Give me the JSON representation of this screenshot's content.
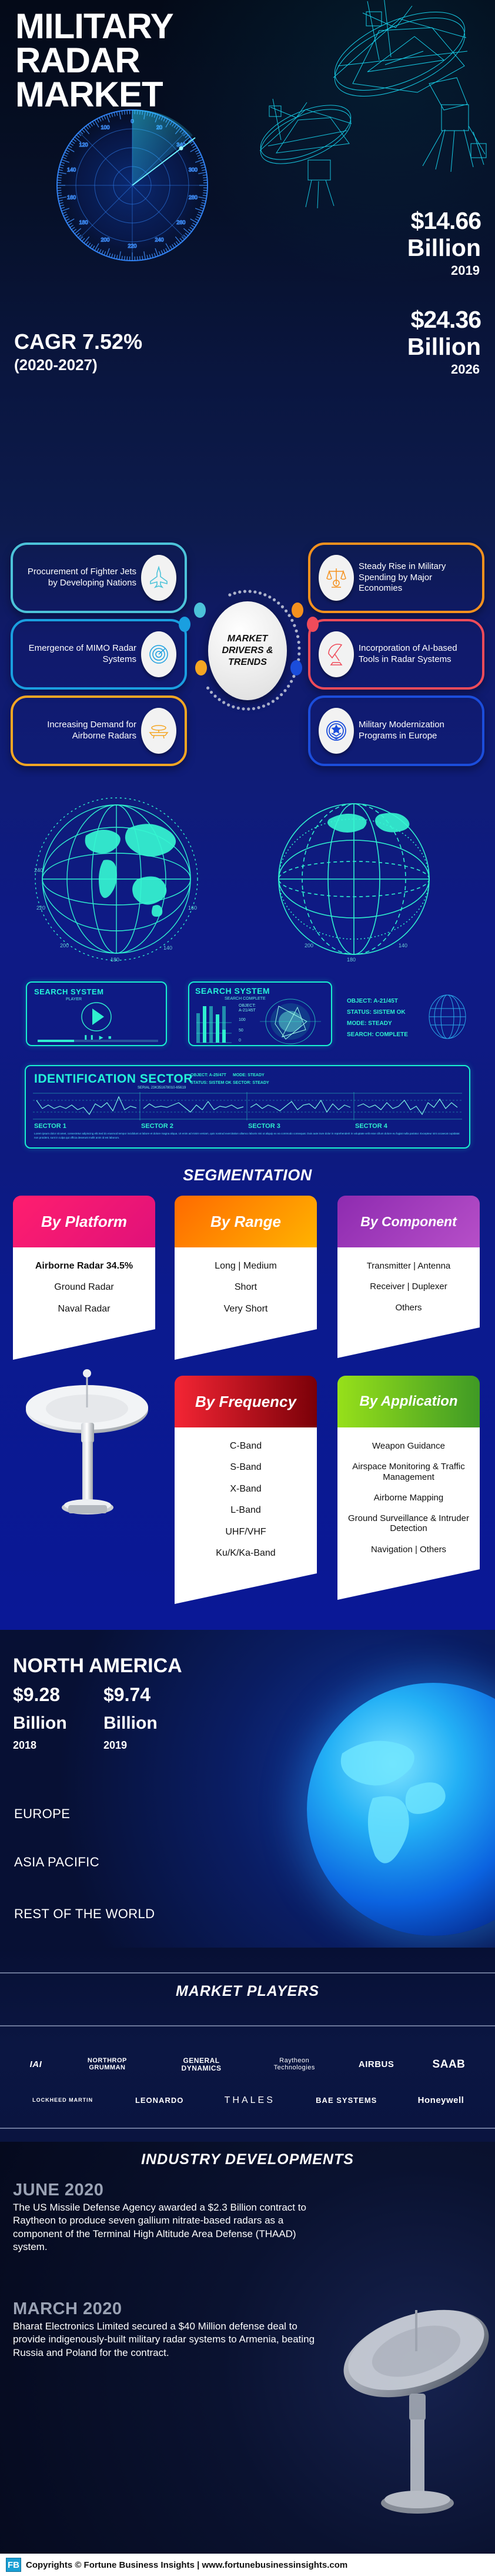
{
  "hero": {
    "title_line1": "MILITARY",
    "title_line2": "RADAR",
    "title_line3": "MARKET",
    "value_2019": "$14.66",
    "value_2019_unit": "Billion",
    "year_2019": "2019",
    "value_2026": "$24.36",
    "value_2026_unit": "Billion",
    "year_2026": "2026",
    "cagr": "CAGR 7.52%",
    "cagr_period": "(2020-2027)",
    "dial_ticks": [
      "0",
      "20",
      "340",
      "300",
      "280",
      "260",
      "240",
      "220",
      "200",
      "180",
      "160",
      "140",
      "120",
      "100"
    ]
  },
  "drivers": {
    "hub_line1": "MARKET",
    "hub_line2": "DRIVERS &",
    "hub_line3": "TRENDS",
    "items": [
      {
        "text": "Procurement of Fighter Jets by Developing Nations",
        "color": "#4cc3d9",
        "icon": "fighter-jet-icon"
      },
      {
        "text": "Steady Rise in Military Spending by Major Economies",
        "color": "#f5911e",
        "icon": "balance-scale-icon"
      },
      {
        "text": "Emergence of MIMO Radar Systems",
        "color": "#1a9fe0",
        "icon": "radar-scope-icon"
      },
      {
        "text": "Incorporation of AI-based Tools in Radar Systems",
        "color": "#ef4b5a",
        "icon": "satellite-dish-icon"
      },
      {
        "text": "Increasing Demand for Airborne Radars",
        "color": "#f5a623",
        "icon": "airborne-radar-icon"
      },
      {
        "text": "Military Modernization Programs in Europe",
        "color": "#1b4ddb",
        "icon": "military-rank-icon"
      }
    ]
  },
  "hud": {
    "player_panel": {
      "title": "SEARCH SYSTEM",
      "subtitle": "PLAYER"
    },
    "search_panel": {
      "title": "SEARCH SYSTEM",
      "subtitle": "SEARCH COMPLETE",
      "object_label": "OBJECT:",
      "object_value": "A-21/45T",
      "axis_ticks": [
        "100",
        "50",
        "0"
      ]
    },
    "status_panel": {
      "lines": [
        "OBJECT: A-21/45T",
        "STATUS: SISTEM OK",
        "MODE: STEADY",
        "SEARCH: COMPLETE"
      ]
    },
    "identification": {
      "title": "IDENTIFICATION SECTOR",
      "serial": "SERIAL 23K351678010-65619",
      "meta": [
        "OBJECT: A-25/47T",
        "MODE:  STEADY",
        "STATUS:  SISTEM OK",
        "SECTOR: STEADY"
      ],
      "sectors": [
        "SECTOR 1",
        "SECTOR 2",
        "SECTOR 3",
        "SECTOR 4"
      ],
      "paragraph": "Lorem ipsum dolor sit amet, consectetur adipiscing elit.Sed do eiusmod tempor incididunt ut labore et dolore magna aliqua. Ut enim ad minim veniam, quis nostrud exercitation ullamco laboris nisi ut aliquip ex ea commodo consequat. Duis aute irure dolor in reprehenderit in voluptate velit esse cillum dolore eu fugiat nulla pariatur. Excepteur sint occaecat cupidatat non proident, sunt in culpa qui officia deserunt mollit anim id est laborum."
    }
  },
  "segmentation": {
    "title": "SEGMENTATION",
    "cards": [
      {
        "title": "By Platform",
        "color_from": "#ff1e6e",
        "color_to": "#e0117a",
        "items": [
          "Airborne Radar 34.5%",
          "Ground Radar",
          "Naval Radar"
        ],
        "bold_first": true
      },
      {
        "title": "By Range",
        "color_from": "#ff6a00",
        "color_to": "#ffb300",
        "items": [
          "Long  |  Medium",
          "Short",
          "Very Short"
        ],
        "bold_first": false
      },
      {
        "title": "By Component",
        "color_from": "#8e2bb0",
        "color_to": "#b64fc8",
        "items": [
          "Transmitter  |  Antenna",
          "Receiver  |  Duplexer",
          "Others"
        ],
        "bold_first": false
      },
      {
        "title": "By Frequency",
        "color_from": "#f42534",
        "color_to": "#7a0008",
        "items": [
          "C-Band",
          "S-Band",
          "X-Band",
          "L-Band",
          "UHF/VHF",
          "Ku/K/Ka-Band"
        ],
        "bold_first": false
      },
      {
        "title": "By Application",
        "color_from": "#97e01a",
        "color_to": "#3f9a25",
        "items": [
          "Weapon Guidance",
          "Airspace Monitoring & Traffic Management",
          "Airborne Mapping",
          "Ground Surveillance & Intruder Detection",
          "Navigation  |  Others"
        ],
        "bold_first": false
      }
    ]
  },
  "regions": {
    "primary": "NORTH AMERICA",
    "values": [
      {
        "amount": "$9.28",
        "unit": "Billion",
        "year": "2018"
      },
      {
        "amount": "$9.74",
        "unit": "Billion",
        "year": "2019"
      }
    ],
    "others": [
      "EUROPE",
      "ASIA PACIFIC",
      "REST OF THE WORLD"
    ]
  },
  "players": {
    "title": "MARKET PLAYERS",
    "row1": [
      "IAI",
      "NORTHROP GRUMMAN",
      "GENERAL DYNAMICS",
      "Raytheon Technologies",
      "AIRBUS",
      "SAAB"
    ],
    "row2": [
      "LOCKHEED MARTIN",
      "LEONARDO",
      "THALES",
      "BAE SYSTEMS",
      "Honeywell"
    ]
  },
  "developments": {
    "title": "INDUSTRY DEVELOPMENTS",
    "entries": [
      {
        "date": "JUNE 2020",
        "text": "The US Missile Defense Agency awarded a $2.3 Billion contract to Raytheon to produce seven gallium nitrate-based radars as a component of the Terminal High Altitude Area Defense (THAAD) system."
      },
      {
        "date": "MARCH 2020",
        "text": "Bharat Electronics Limited secured a $40 Million defense deal to provide indigenously-built military radar systems to Armenia, beating Russia and Poland for the contract."
      }
    ]
  },
  "footer": {
    "logo_text": "FB",
    "text": "Copyrights © Fortune Business Insights | www.fortunebusinessinsights.com"
  }
}
